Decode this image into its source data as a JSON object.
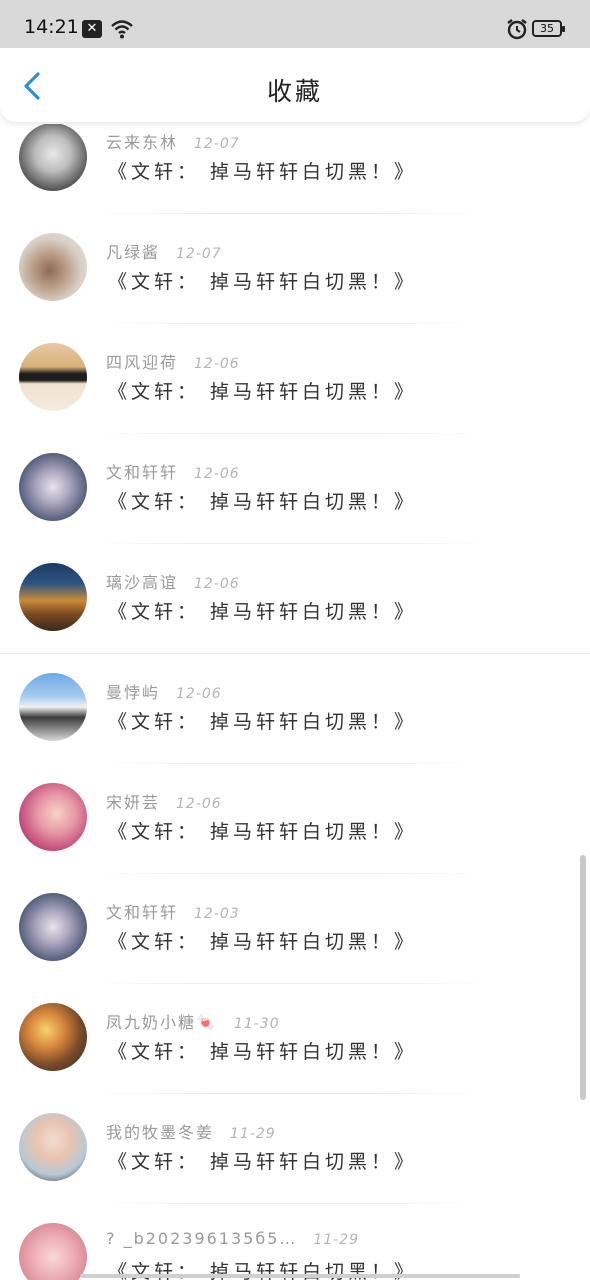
{
  "status_bar": {
    "time": "14:21",
    "notification_icon": "x-mark-icon",
    "wifi_icon": "wifi-icon",
    "alarm_icon": "alarm-clock-icon",
    "battery": "35"
  },
  "header": {
    "back_icon": "chevron-left-icon",
    "title": "收藏"
  },
  "items": [
    {
      "name": "云来东林",
      "date": "12-07",
      "content": "《文轩： 掉马轩轩白切黑！》"
    },
    {
      "name": "凡绿酱",
      "date": "12-07",
      "content": "《文轩： 掉马轩轩白切黑！》"
    },
    {
      "name": "四风迎荷",
      "date": "12-06",
      "content": "《文轩： 掉马轩轩白切黑！》"
    },
    {
      "name": "文和轩轩",
      "date": "12-06",
      "content": "《文轩： 掉马轩轩白切黑！》"
    },
    {
      "name": "璃沙高谊",
      "date": "12-06",
      "content": "《文轩： 掉马轩轩白切黑！》"
    },
    {
      "name": "曼悖屿",
      "date": "12-06",
      "content": "《文轩： 掉马轩轩白切黑！》"
    },
    {
      "name": "宋妍芸",
      "date": "12-06",
      "content": "《文轩： 掉马轩轩白切黑！》"
    },
    {
      "name": "文和轩轩",
      "date": "12-03",
      "content": "《文轩： 掉马轩轩白切黑！》"
    },
    {
      "name": "凤九奶小糖🍬",
      "date": "11-30",
      "content": "《文轩： 掉马轩轩白切黑！》"
    },
    {
      "name": "我的牧墨冬姜",
      "date": "11-29",
      "content": "《文轩： 掉马轩轩白切黑！》"
    },
    {
      "name": "? _b202396135б5…",
      "date": "11-29",
      "content": "《文轩： 掉马轩轩白切黑！》"
    }
  ],
  "colors": {
    "accent": "#2a8fd8",
    "status_bar_bg": "#d9d9d9",
    "meta_text": "#9a9a9a",
    "content_text": "#333333"
  }
}
